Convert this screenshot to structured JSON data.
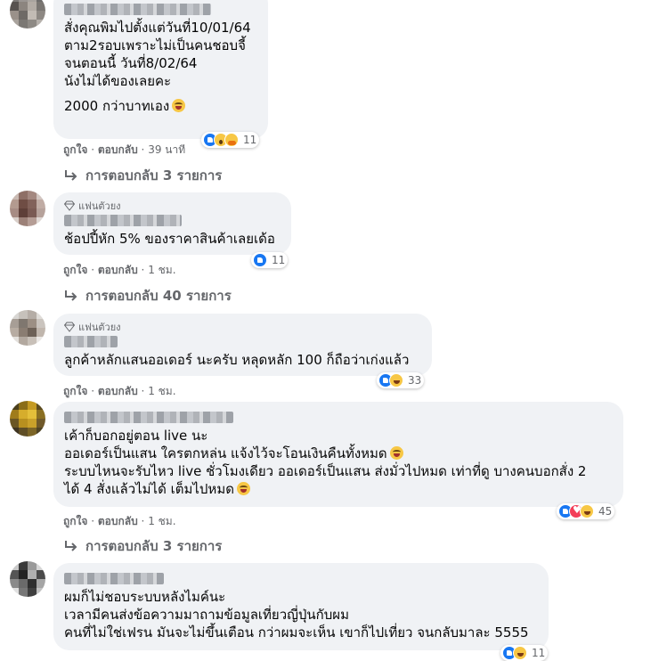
{
  "colors": {
    "bubble": "#f0f2f5",
    "secondary_text": "#65676b",
    "like_blue": "#1877f2",
    "love_red": "#f33e58",
    "emoji_yellow": "#f7c745"
  },
  "comments": [
    {
      "lines": [
        "สั่งคุณพิมไปตั้งแต่วันที่10/01/64",
        "ตาม2รอบเพราะไม่เป็นคนชอบจี้",
        "จนตอนนี้ วันที่8/02/64",
        "นังไม่ได้ของเลยคะ"
      ],
      "last_line": "2000 กว่าบาทเอง",
      "meta": {
        "like": "ถูกใจ",
        "reply": "ตอบกลับ",
        "time": "39 นาที"
      },
      "reaction_icons": [
        "like-icon",
        "wow-icon",
        "care-icon"
      ],
      "reaction_count": "11",
      "replies": "การตอบกลับ 3 รายการ"
    },
    {
      "badge": "แฟนตัวยง",
      "lines": [
        "ช้อปปี้หัก 5% ของราคาสินค้าเลยเด้อ"
      ],
      "meta": {
        "like": "ถูกใจ",
        "reply": "ตอบกลับ",
        "time": "1 ชม."
      },
      "reaction_icons": [
        "like-icon"
      ],
      "reaction_count": "11",
      "replies": "การตอบกลับ 40 รายการ"
    },
    {
      "badge": "แฟนตัวยง",
      "lines": [
        "ลูกค้าหลักแสนออเดอร์ นะครับ หลุดหลัก 100 ก็ถือว่าเก่งแล้ว"
      ],
      "meta": {
        "like": "ถูกใจ",
        "reply": "ตอบกลับ",
        "time": "1 ชม."
      },
      "reaction_icons": [
        "like-icon",
        "haha-icon"
      ],
      "reaction_count": "33"
    },
    {
      "lines": [
        "เค้าก็บอกอยู่ตอน live นะ",
        "ออเดอร์เป็นแสน ใครตกหล่น แจ้งไว้จะโอนเงินคืนทั้งหมด",
        "ระบบไหนจะรับไหว live ชั่วโมงเดียว ออเดอร์เป็นแสน ส่งมั่วไปหมด เท่าที่ดู บางคนบอกสั่ง 2",
        "ได้ 4 สั่งแล้วไม่ได้ เต็มไปหมด"
      ],
      "meta": {
        "like": "ถูกใจ",
        "reply": "ตอบกลับ",
        "time": "1 ชม."
      },
      "reaction_icons": [
        "like-icon",
        "love-icon",
        "haha-icon"
      ],
      "reaction_count": "45",
      "replies": "การตอบกลับ 3 รายการ"
    },
    {
      "lines": [
        "ผมก็ไม่ชอบระบบหลังไมค์นะ",
        "เวลามีคนส่งข้อความมาถามข้อมูลเที่ยวญี่ปุ่นกับผม",
        "คนที่ไม่ใช่เฟรน มันจะไม่ขึ้นเตือน กว่าผมจะเห็น เขาก็ไปเที่ยว จนกลับมาละ 5555"
      ],
      "reaction_icons": [
        "like-icon",
        "haha-icon"
      ],
      "reaction_count": "11"
    }
  ]
}
